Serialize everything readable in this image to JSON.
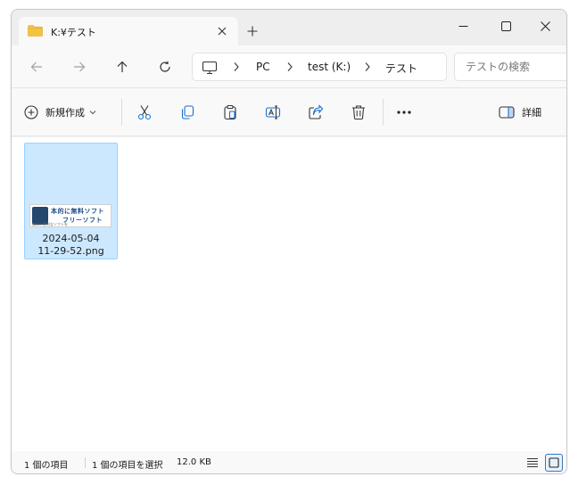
{
  "tab": {
    "title": "K:¥テスト"
  },
  "address": {
    "segments": [
      "PC",
      "test (K:)",
      "テスト"
    ]
  },
  "search": {
    "placeholder": "テストの検索"
  },
  "commandbar": {
    "new_label": "新規作成",
    "details_label": "詳細"
  },
  "files": [
    {
      "name_line1": "2024-05-04",
      "name_line2": "11-29-52.png",
      "thumbnail": {
        "line1": "本的に無料ソフト",
        "line2": "フリーソフト",
        "line3": "無料で便利なソフトを"
      }
    }
  ],
  "status": {
    "item_count": "1 個の項目",
    "selection": "1 個の項目を選択",
    "size": "12.0 KB"
  },
  "colors": {
    "accent": "#0067c0",
    "selection_bg": "#cce8ff",
    "selection_border": "#99d1ff",
    "folder": "#f5c342"
  },
  "icons": [
    "folder-icon",
    "close-icon",
    "plus-icon",
    "minimize-icon",
    "maximize-icon",
    "back-arrow-icon",
    "forward-arrow-icon",
    "up-arrow-icon",
    "refresh-icon",
    "computer-icon",
    "chevron-right-icon",
    "new-icon",
    "chevron-down-icon",
    "cut-icon",
    "copy-icon",
    "paste-icon",
    "rename-icon",
    "share-icon",
    "delete-icon",
    "more-icon",
    "details-pane-icon",
    "details-view-icon",
    "tiles-view-icon"
  ]
}
